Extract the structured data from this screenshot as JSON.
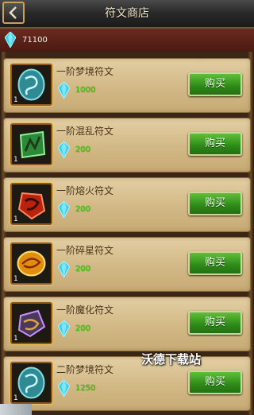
{
  "header": {
    "title": "符文商店",
    "back_icon": "back-arrow-icon"
  },
  "wallet": {
    "currency_icon": "crystal-gem-icon",
    "amount": "71100"
  },
  "shop_items": [
    {
      "name": "一阶梦境符文",
      "qty": "1",
      "price": "1000",
      "buy_label": "购买",
      "icon": "dream-rune-icon",
      "color": "#4fb0b8"
    },
    {
      "name": "一阶混乱符文",
      "qty": "1",
      "price": "200",
      "buy_label": "购买",
      "icon": "chaos-rune-icon",
      "color": "#3aa24a"
    },
    {
      "name": "一阶熔火符文",
      "qty": "1",
      "price": "200",
      "buy_label": "购买",
      "icon": "molten-rune-icon",
      "color": "#c8281a"
    },
    {
      "name": "一阶碎星符文",
      "qty": "1",
      "price": "200",
      "buy_label": "购买",
      "icon": "star-rune-icon",
      "color": "#e29a14"
    },
    {
      "name": "一阶魔化符文",
      "qty": "1",
      "price": "200",
      "buy_label": "购买",
      "icon": "demon-rune-icon",
      "color": "#6a4a82"
    },
    {
      "name": "二阶梦境符文",
      "qty": "1",
      "price": "1250",
      "buy_label": "购买",
      "icon": "dream-rune-icon",
      "color": "#4fb0b8"
    }
  ],
  "watermark": "沃德下载站",
  "colors": {
    "price_green": "#3cd40a",
    "buy_button": "#2e8a18",
    "banner_red": "#6b2a1f"
  }
}
